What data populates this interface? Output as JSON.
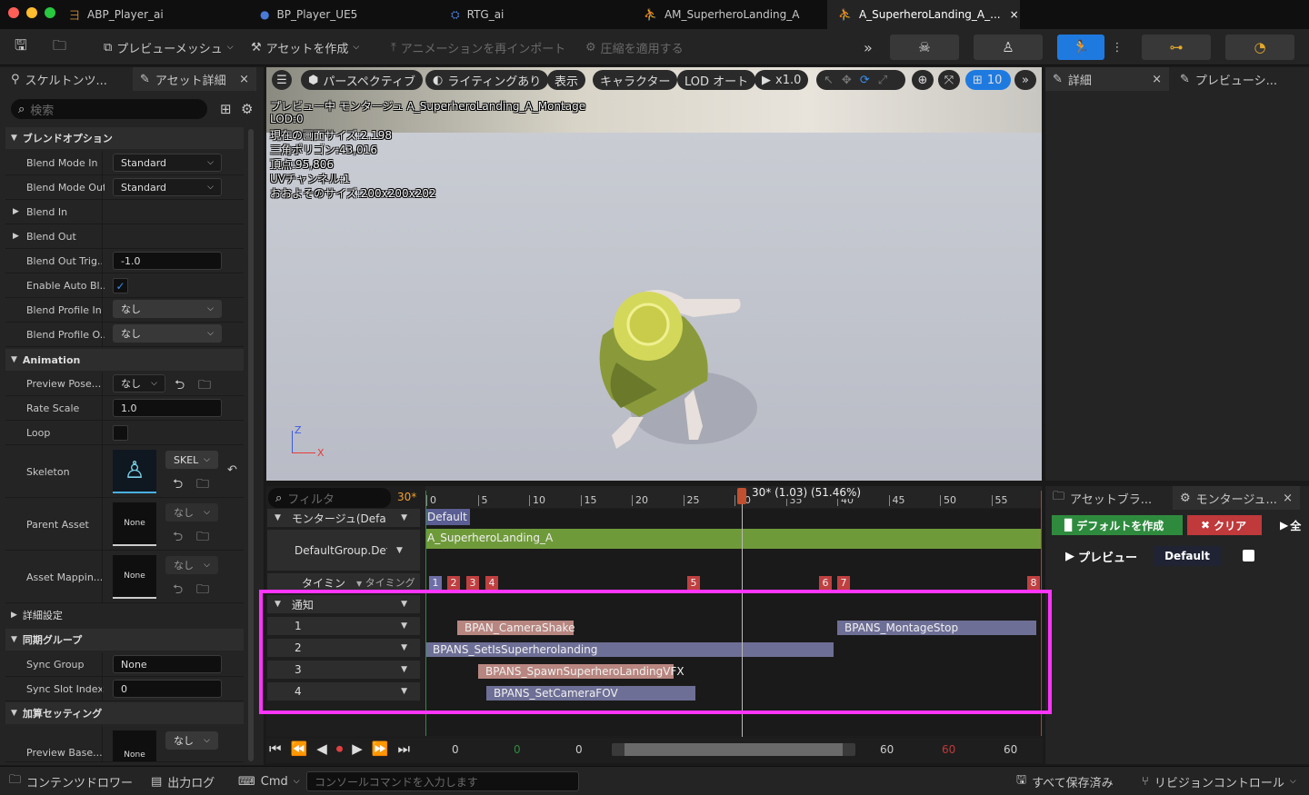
{
  "doc_tabs": [
    {
      "label": "ABP_Player_ai",
      "icon": "anim-blueprint-icon"
    },
    {
      "label": "BP_Player_UE5",
      "icon": "blueprint-pawn-icon"
    },
    {
      "label": "RTG_ai",
      "icon": "retargeter-icon"
    },
    {
      "label": "AM_SuperheroLanding_A",
      "icon": "anim-montage-icon"
    },
    {
      "label": "A_SuperheroLanding_A_...",
      "icon": "anim-sequence-icon",
      "close": "×"
    }
  ],
  "toolbar": {
    "preview_mesh": "プレビューメッシュ",
    "create_asset": "アセットを作成",
    "reimport": "アニメーションを再インポート",
    "apply_compression": "圧縮を適用する"
  },
  "left_tabs": [
    {
      "label": "スケルトンツ..."
    },
    {
      "label": "アセット詳細",
      "close": "×"
    }
  ],
  "left_search": {
    "placeholder": "検索"
  },
  "categories": {
    "blend_options": "ブレンドオプション",
    "animation": "Animation",
    "advanced": "詳細設定",
    "sync_group": "同期グループ",
    "additive": "加算セッティング"
  },
  "props": {
    "blend_mode_in": {
      "label": "Blend Mode In",
      "value": "Standard"
    },
    "blend_mode_out": {
      "label": "Blend Mode Out",
      "value": "Standard"
    },
    "blend_in": {
      "label": "Blend In"
    },
    "blend_out": {
      "label": "Blend Out"
    },
    "blend_out_trigger": {
      "label": "Blend Out Trig...",
      "value": "-1.0"
    },
    "enable_auto_blend": {
      "label": "Enable Auto Bl...",
      "checked": true,
      "check": "✓"
    },
    "blend_profile_in": {
      "label": "Blend Profile In",
      "value": "なし"
    },
    "blend_profile_out": {
      "label": "Blend Profile O...",
      "value": "なし"
    },
    "preview_pose": {
      "label": "Preview Pose...",
      "value": "なし"
    },
    "rate_scale": {
      "label": "Rate Scale",
      "value": "1.0"
    },
    "loop": {
      "label": "Loop",
      "checked": false
    },
    "skeleton": {
      "label": "Skeleton",
      "value": "SKEL"
    },
    "parent_asset": {
      "label": "Parent Asset",
      "thumb": "None",
      "value": "なし"
    },
    "asset_mapping": {
      "label": "Asset Mappin...",
      "thumb": "None",
      "value": "なし"
    },
    "sync_group": {
      "label": "Sync Group",
      "value": "None"
    },
    "sync_slot_index": {
      "label": "Sync Slot Index",
      "value": "0"
    },
    "preview_base": {
      "label": "Preview Base...",
      "thumb": "None",
      "value": "なし"
    }
  },
  "viewport": {
    "perspective": "パースペクティブ",
    "lighting": "ライティングあり",
    "show": "表示",
    "character": "キャラクター",
    "lod": "LOD オート",
    "play_rate": "x1.0",
    "grid_value": "10",
    "stats": [
      "プレビュー中 モンタージュ A_SuperheroLanding_A_Montage",
      "LOD:0",
      "現在の画面サイズ:2.198",
      "三角ポリゴン:43,016",
      "頂点:95,806",
      "UVチャンネル:1",
      "おおよそのサイズ:200x200x202"
    ],
    "axis_z": "Z",
    "axis_x": "X"
  },
  "right_top_tabs": [
    {
      "label": "詳細",
      "close": "×"
    },
    {
      "label": "プレビューシ..."
    }
  ],
  "right_bottom_tabs": [
    {
      "label": "アセットブラ..."
    },
    {
      "label": "モンタージュ...",
      "close": "×"
    }
  ],
  "montage_panel": {
    "create_default": "デフォルトを作成",
    "clear": "クリア",
    "all": "全",
    "preview": "プレビュー",
    "default": "Default"
  },
  "timeline": {
    "filter_placeholder": "フィルタ",
    "fps": "30*",
    "playhead": "30* (1.03) (51.46%)",
    "ticks": [
      "0",
      "5",
      "10",
      "15",
      "20",
      "25",
      "30",
      "35",
      "40",
      "45",
      "50",
      "55"
    ],
    "montage_label": "モンタージュ(Defa",
    "group_label": "DefaultGroup.Defa",
    "timing_label": "タイミン",
    "timing_dropdown": "タイミング",
    "notify_label": "通知",
    "section_name": "Default",
    "anim_segment": "A_SuperheroLanding_A",
    "timing_markers": [
      "1",
      "2",
      "3",
      "4",
      "5",
      "6",
      "7",
      "8"
    ],
    "notify_tracks": [
      "1",
      "2",
      "3",
      "4"
    ],
    "notifies": [
      {
        "name": "BPAN_CameraShake",
        "track": 1
      },
      {
        "name": "BPANS_MontageStop",
        "track": 1
      },
      {
        "name": "BPANS_SetIsSuperherolanding",
        "track": 2
      },
      {
        "name": "BPANS_SpawnSuperheroLandingVFX",
        "track": 3
      },
      {
        "name": "BPANS_SetCameraFOV",
        "track": 4
      }
    ],
    "transport_values": [
      "0",
      "0",
      "0",
      "60",
      "60",
      "60"
    ]
  },
  "statusbar": {
    "content_drawer": "コンテンツドロワー",
    "output_log": "出力ログ",
    "cmd": "Cmd",
    "console_placeholder": "コンソールコマンドを入力します",
    "all_saved": "すべて保存済み",
    "revision_control": "リビジョンコントロール"
  },
  "colors": {
    "accent_blue": "#1f7ae0",
    "green_button": "#2e8b3e",
    "red_button": "#c0393b",
    "anim_segment": "#6f9a3a",
    "notify_state": "#6e6f96",
    "notify_pink": "#b88680",
    "highlight": "#ff35ff"
  }
}
